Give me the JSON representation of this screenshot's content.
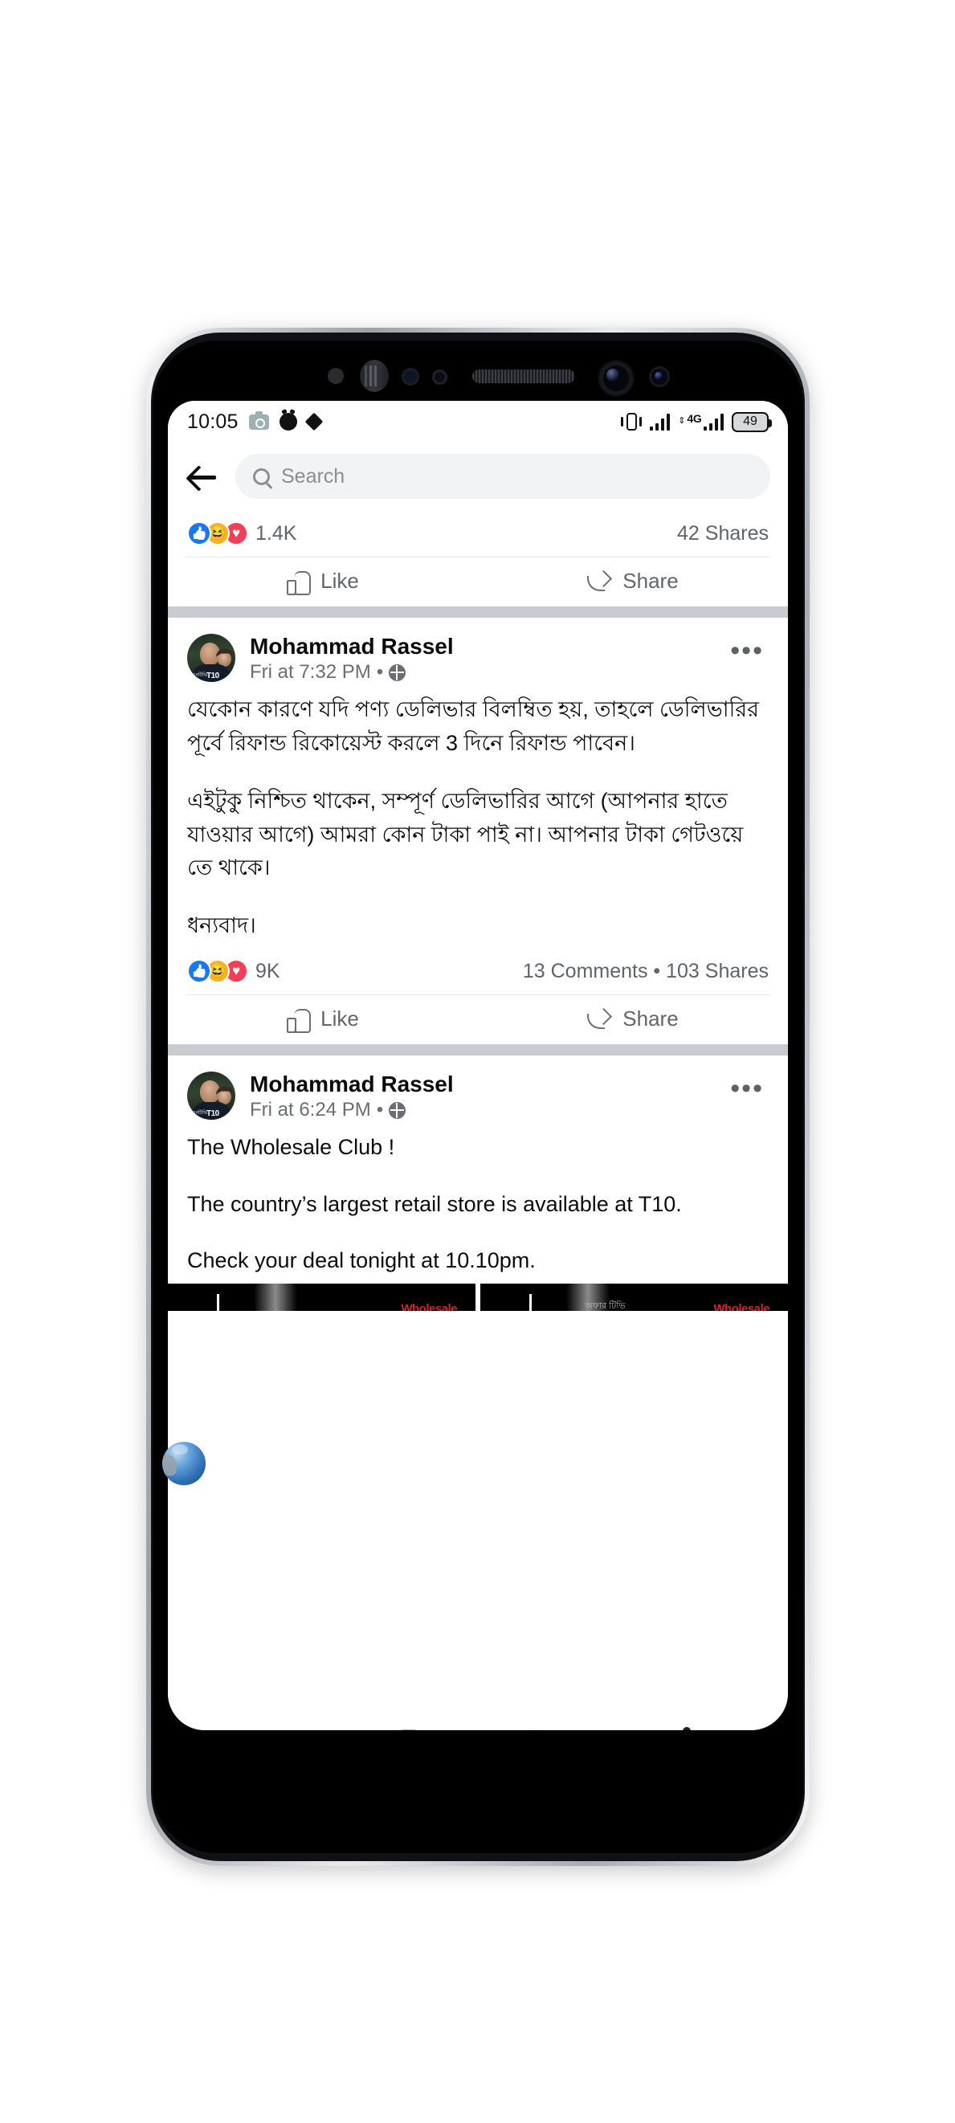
{
  "device": {
    "platform": "android-phone",
    "statusbar": {
      "time": "10:05",
      "left_icons": [
        "camera-icon",
        "alarm-icon",
        "diamond-icon"
      ],
      "right_icons": [
        "vibrate-icon",
        "signal-bars-icon",
        "signal-bars-4g-icon",
        "battery-icon"
      ],
      "network_label": "4G",
      "battery_percent": "49"
    },
    "navbar": {
      "recents_label": "recents-icon",
      "home_label": "home-icon",
      "back_label": "back-icon",
      "accessibility_label": "accessibility-icon"
    }
  },
  "header": {
    "back_button": "back-arrow-icon",
    "search_placeholder": "Search",
    "search_value": ""
  },
  "colors": {
    "brand_blue": "#1877f2",
    "like_blue": "#1877f2",
    "haha_yellow": "#f7b125",
    "love_red": "#f33e58",
    "divider_gray": "#c8cbd0",
    "secondary_text": "#606468",
    "field_bg": "#f2f3f5"
  },
  "actions": {
    "like_label": "Like",
    "share_label": "Share"
  },
  "feed": {
    "posts": [
      {
        "id": "post-partial-top",
        "reactions_count": "1.4K",
        "reaction_icons": [
          "like",
          "haha",
          "love"
        ],
        "meta_right": "42 Shares"
      },
      {
        "id": "post-bengali-refund",
        "author": "Mohammad Rassel",
        "timestamp": "Fri at 7:32 PM",
        "privacy_icon": "globe-icon",
        "menu_icon": "ellipsis-icon",
        "paragraphs": [
          "যেকোন কারণে যদি পণ্য ডেলিভার বিলম্বিত হয়, তাহলে ডেলিভারির পূর্বে রিফান্ড রিকোয়েস্ট করলে 3 দিনে রিফান্ড পাবেন।",
          "এইটুকু নিশ্চিত থাকেন, সম্পূর্ণ ডেলিভারির আগে (আপনার হাতে যাওয়ার আগে) আমরা কোন টাকা পাই না। আপনার টাকা গেটওয়ে তে থাকে।",
          "ধন্যবাদ।"
        ],
        "reactions_count": "9K",
        "reaction_icons": [
          "like",
          "haha",
          "love"
        ],
        "meta_right": "13 Comments • 103 Shares"
      },
      {
        "id": "post-wholesale-club",
        "author": "Mohammad Rassel",
        "timestamp": "Fri at 6:24 PM",
        "privacy_icon": "globe-icon",
        "menu_icon": "ellipsis-icon",
        "paragraphs": [
          "The Wholesale Club !",
          "The country’s largest retail store is available at T10.",
          "Check your deal tonight at 10.10pm."
        ],
        "attachment": {
          "type": "photo-grid-partial",
          "cells": [
            {
              "overlay_text": "Wholesale",
              "sub_text": ""
            },
            {
              "overlay_text": "Wholesale",
              "sub_text": "অফার টিভি"
            }
          ]
        }
      }
    ]
  }
}
